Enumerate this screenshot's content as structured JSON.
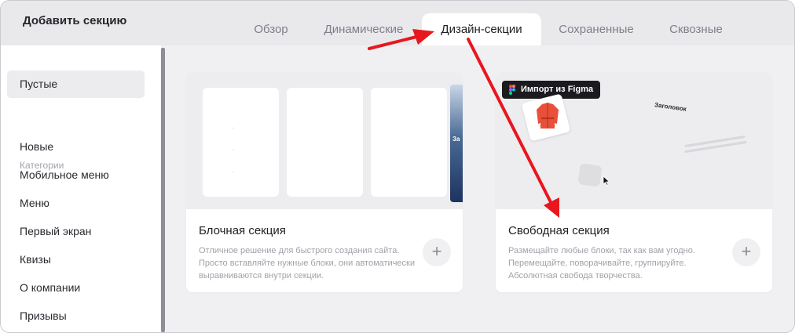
{
  "header": {
    "title": "Добавить секцию",
    "tabs": [
      {
        "label": "Обзор"
      },
      {
        "label": "Динамические"
      },
      {
        "label": "Дизайн-секции"
      },
      {
        "label": "Сохраненные"
      },
      {
        "label": "Сквозные"
      }
    ],
    "active_tab": "Дизайн-секции"
  },
  "sidebar": {
    "empty_item": "Пустые",
    "category_heading": "Категории",
    "items": [
      {
        "label": "Новые"
      },
      {
        "label": "Мобильное меню"
      },
      {
        "label": "Меню"
      },
      {
        "label": "Первый экран"
      },
      {
        "label": "Квизы"
      },
      {
        "label": "О компании"
      },
      {
        "label": "Призывы"
      }
    ]
  },
  "cards": [
    {
      "title": "Блочная секция",
      "description": "Отличное решение для быстрого создания сайта. Просто вставляйте нужные блоки, они автоматически выравниваются внутри секции.",
      "preview_snippet": "За"
    },
    {
      "title": "Свободная секция",
      "description": "Размещайте любые блоки, так как вам угодно. Перемещайте, поворачивайте, группируйте. Абсолютная свобода творчества.",
      "badge": "Импорт из Figma",
      "preview_heading": "Заголовок"
    }
  ],
  "icons": {
    "add": "plus-icon",
    "figma": "figma-logo-icon",
    "cursor": "mouse-pointer-icon"
  },
  "colors": {
    "annotation_arrow": "#e8171e",
    "active_tab_bg": "#ffffff",
    "header_bg": "#e9e9ec",
    "badge_bg": "#1b1b1f"
  }
}
